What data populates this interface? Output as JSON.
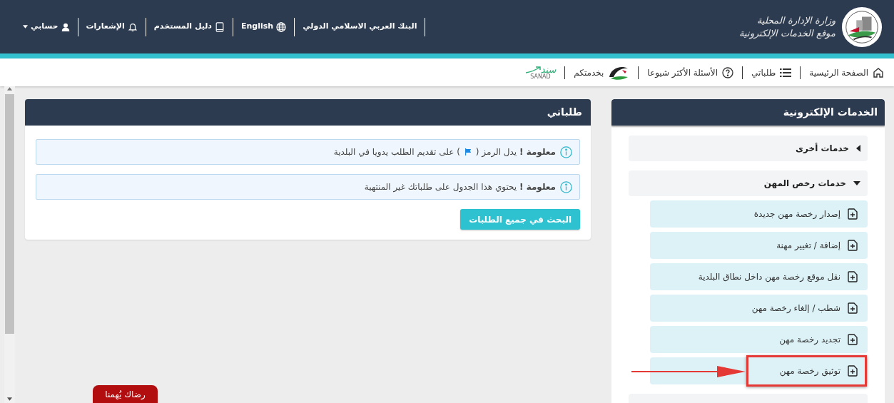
{
  "logo": {
    "line1": "وزارة الإدارة المحلية",
    "line2": "موقع الخدمات الإلكترونية"
  },
  "top_links": [
    {
      "kind": "text",
      "label": "البنك العربي الاسلامي الدولي"
    },
    {
      "kind": "globe",
      "label": "English"
    },
    {
      "kind": "book",
      "label": "دليل المستخدم"
    },
    {
      "kind": "bell",
      "label": "الإشعارات"
    },
    {
      "kind": "user",
      "label": "حسابي"
    }
  ],
  "nav": [
    {
      "kind": "home",
      "label": "الصفحة الرئيسية"
    },
    {
      "kind": "list",
      "label": "طلباتي"
    },
    {
      "kind": "help",
      "label": "الأسئلة الأكثر شيوعا"
    },
    {
      "kind": "flag-logo",
      "label": "بخدمتكم"
    },
    {
      "kind": "sanad",
      "label": "سند",
      "sublabel": "SANAD"
    }
  ],
  "services": {
    "title": "الخدمات الإلكترونية",
    "groups": [
      {
        "label": "خدمات أخرى",
        "expanded": false
      },
      {
        "label": "خدمات رخص المهن",
        "expanded": true,
        "children": [
          {
            "label": "إصدار رخصة مهن جديدة",
            "highlighted": false
          },
          {
            "label": "إضافة / تغيير مهنة",
            "highlighted": false
          },
          {
            "label": "نقل موقع رخصة مهن داخل نطاق البلدية",
            "highlighted": false
          },
          {
            "label": "شطب / إلغاء رخصة مهن",
            "highlighted": false
          },
          {
            "label": "تجديد رخصة مهن",
            "highlighted": false
          },
          {
            "label": "توثيق رخصة مهن",
            "highlighted": true
          }
        ]
      }
    ]
  },
  "requests": {
    "title": "طلباتي",
    "alerts": [
      {
        "before": "**معلومة !** يدل الرمز (",
        "flag": true,
        "after": ") على تقديم الطلب يدويا في البلدية"
      },
      {
        "before": "**معلومة !** يحتوي هذا الجدول على طلباتك غير المنتهية",
        "flag": false
      }
    ],
    "button": "البحث في جميع الطلبات"
  },
  "feedback": "رضاك يُهمنا"
}
